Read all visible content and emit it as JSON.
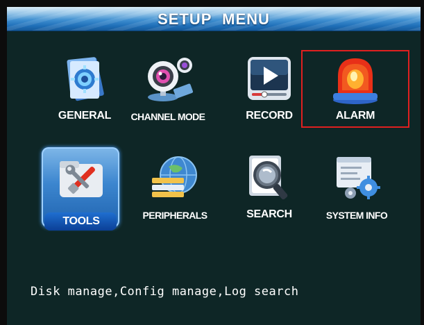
{
  "window": {
    "title": "SETUP MENU"
  },
  "menu": {
    "items": [
      {
        "id": "general",
        "label": "GENERAL",
        "icon": "general-settings-icon"
      },
      {
        "id": "channel-mode",
        "label": "CHANNEL MODE",
        "icon": "webcam-icon"
      },
      {
        "id": "record",
        "label": "RECORD",
        "icon": "record-player-icon"
      },
      {
        "id": "alarm",
        "label": "ALARM",
        "icon": "alarm-siren-icon"
      },
      {
        "id": "tools",
        "label": "TOOLS",
        "icon": "tools-icon"
      },
      {
        "id": "peripherals",
        "label": "PERIPHERALS",
        "icon": "globe-peripherals-icon"
      },
      {
        "id": "search",
        "label": "SEARCH",
        "icon": "magnifier-search-icon"
      },
      {
        "id": "system-info",
        "label": "SYSTEM INFO",
        "icon": "system-info-gears-icon"
      }
    ],
    "selected": "TOOLS",
    "highlighted": "ALARM"
  },
  "status": {
    "description": "Disk manage,Config manage,Log search"
  },
  "colors": {
    "background": "#0e2626",
    "title_bar": "#2a7cc4",
    "highlight_border": "#e02020",
    "selection": "#3c86cf",
    "text": "#ffffff"
  }
}
